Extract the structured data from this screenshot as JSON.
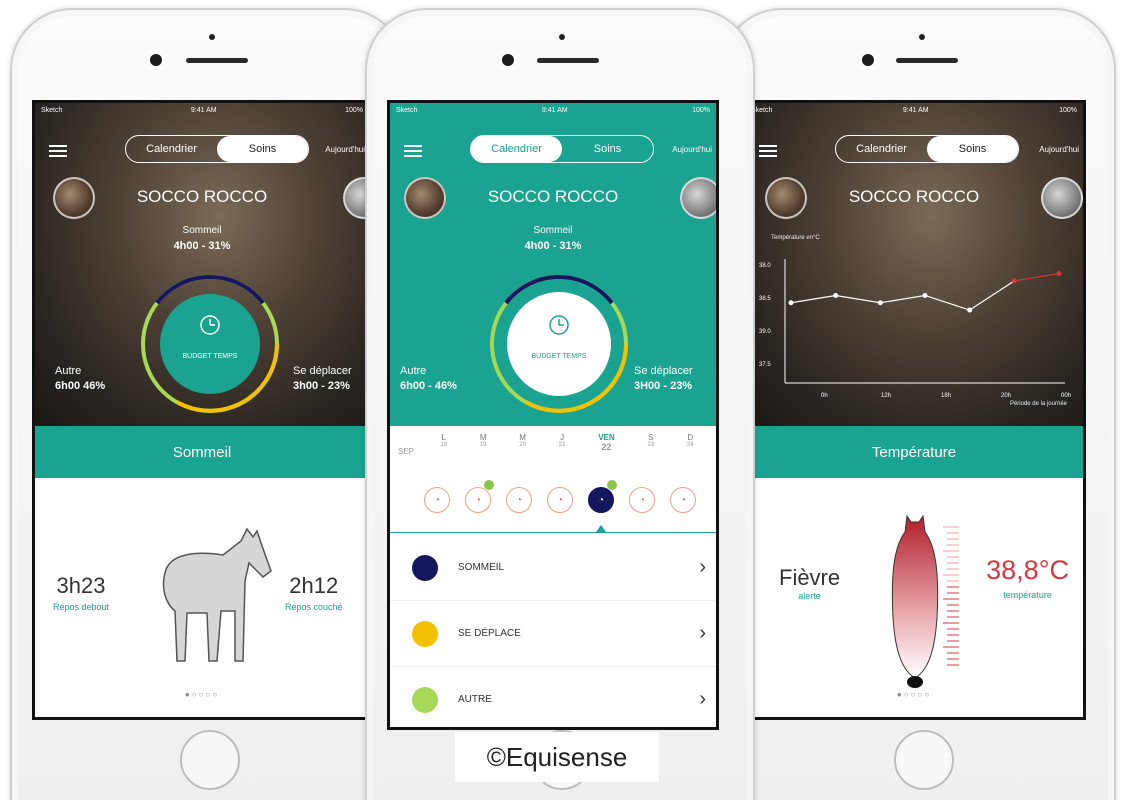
{
  "colors": {
    "teal": "#1aa390",
    "navy": "#14165e",
    "yellow": "#f2c200",
    "green": "#a7d957",
    "red": "#d8383d"
  },
  "status": {
    "carrier": "Sketch",
    "time": "9:41 AM",
    "battery": "100%"
  },
  "phone1": {
    "tabs": [
      "Calendrier",
      "Soins"
    ],
    "active_tab": "Soins",
    "today": "Aujourd'hui",
    "horse": "SOCCO ROCCO",
    "sleep": {
      "label": "Sommeil",
      "value": "4h00 - 31%"
    },
    "budget": "BUDGET TEMPS",
    "other": {
      "label": "Autre",
      "value": "6h00 46%"
    },
    "move": {
      "label": "Se déplacer",
      "value": "3h00 - 23%"
    },
    "band": "Sommeil",
    "standing": {
      "value": "3h23",
      "label": "Repos debout"
    },
    "lying": {
      "value": "2h12",
      "label": "Repos couché"
    },
    "pager": "●○○○○"
  },
  "phone2": {
    "tabs": [
      "Calendrier",
      "Soins"
    ],
    "active_tab": "Calendrier",
    "today": "Aujourd'hui",
    "horse": "SOCCO ROCCO",
    "sleep": {
      "label": "Sommeil",
      "value": "4h00 - 31%"
    },
    "budget": "BUDGET TEMPS",
    "other": {
      "label": "Autre",
      "value": "6h00 - 46%"
    },
    "move": {
      "label": "Se déplacer",
      "value": "3H00 - 23%"
    },
    "month": "SEP",
    "days": [
      {
        "d": "L",
        "n": "18"
      },
      {
        "d": "M",
        "n": "19"
      },
      {
        "d": "M",
        "n": "20"
      },
      {
        "d": "J",
        "n": "21"
      },
      {
        "d": "VEN",
        "n": "22"
      },
      {
        "d": "S",
        "n": "23"
      },
      {
        "d": "D",
        "n": "24"
      }
    ],
    "selected_day_index": 4,
    "list": [
      {
        "label": "SOMMEIL",
        "color": "#14165e"
      },
      {
        "label": "SE DÉPLACE",
        "color": "#f2c200"
      },
      {
        "label": "AUTRE",
        "color": "#a7d957"
      }
    ]
  },
  "phone3": {
    "tabs": [
      "Calendrier",
      "Soins"
    ],
    "active_tab": "Soins",
    "today": "Aujourd'hui",
    "horse": "SOCCO ROCCO",
    "chart_title": "Température en°C",
    "chart_note": "Période de la journée",
    "band": "Température",
    "status": {
      "value": "Fièvre",
      "label": "alerte"
    },
    "temperature": {
      "value": "38,8°C",
      "label": "température"
    },
    "pager": "●○○○○"
  },
  "chart_data": {
    "type": "line",
    "title": "Température en°C",
    "xlabel": "Période de la journée",
    "x_ticks": [
      "0h",
      "12h",
      "18h",
      "20h",
      "00h"
    ],
    "y_ticks": [
      "38.0",
      "38.5",
      "39.0",
      "37.5"
    ],
    "series": [
      {
        "values": [
          38.6,
          38.7,
          38.6,
          38.7,
          38.5,
          38.9,
          39.0
        ]
      }
    ]
  },
  "copyright": "©Equisense"
}
